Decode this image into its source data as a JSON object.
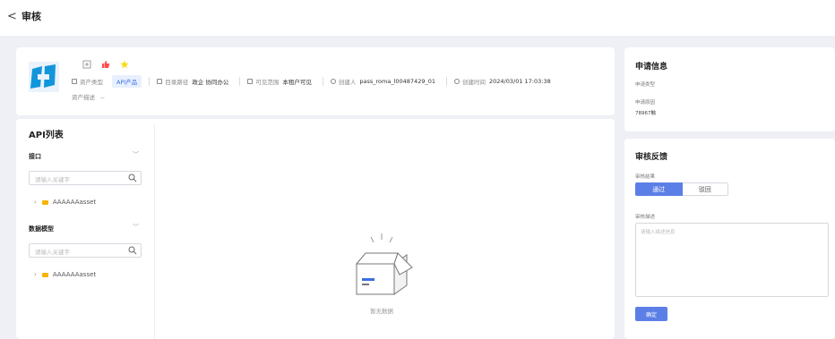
{
  "topbar": {
    "back_glyph": "<",
    "title": "审核"
  },
  "asset": {
    "asset_type_label": "资产类型",
    "asset_type_tag": "API产品",
    "catalog_label": "目录路径",
    "catalog_value": "政企 协同办公",
    "visibility_label": "可见范围",
    "visibility_value": "本租户可见",
    "creator_label": "创建人",
    "creator_value": "pass_roma_l00487429_01",
    "created_label": "创建时间",
    "created_value": "2024/03/01 17:03:38",
    "desc_label": "资产描述",
    "desc_value": "--"
  },
  "api_list": {
    "title": "API列表",
    "sections": [
      {
        "label": "接口",
        "search_placeholder": "请输入关键字",
        "node": "AAAAAAasset"
      },
      {
        "label": "数据模型",
        "search_placeholder": "请输入关键字",
        "node": "AAAAAAasset"
      }
    ],
    "empty_text": "暂无数据"
  },
  "application": {
    "title": "申请信息",
    "type_label": "申请类型",
    "reason_label": "申请原因",
    "reason_value": "78967触"
  },
  "feedback": {
    "title": "审核反馈",
    "result_label": "审核结果",
    "approve": "通过",
    "reject": "驳回",
    "desc_label": "审核描述",
    "desc_placeholder": "请输入描述信息",
    "confirm": "确定"
  },
  "colors": {
    "primary": "#5b7fe6",
    "folder": "#f7b500",
    "like": "#ff4d4f",
    "star": "#fadb14"
  }
}
